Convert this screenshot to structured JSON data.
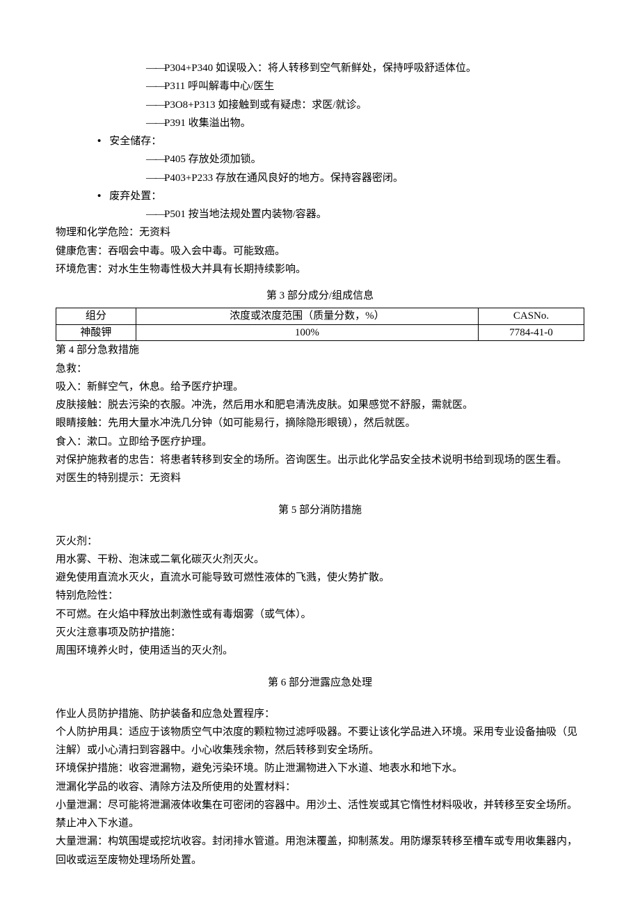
{
  "top": {
    "l1": "P304+P340 如误吸入：将人转移到空气新鲜处，保持呼吸舒适体位。",
    "l2": "P311 呼叫解毒中心/医生",
    "l3": "P3O8+P313 如接触到或有疑虑：求医/就诊。",
    "l4": "P391 收集溢出物。",
    "storage_label": "安全储存：",
    "s1": "P405 存放处须加锁。",
    "s2": "P403+P233 存放在通风良好的地方。保持容器密闭。",
    "disposal_label": "废弃处置：",
    "d1": "P501 按当地法规处置内装物/容器。",
    "phys": "物理和化学危险：无资料",
    "health": "健康危害：吞咽会中毒。吸入会中毒。可能致癌。",
    "env": "环境危害：对水生生物毒性极大并具有长期持续影响。"
  },
  "s3": {
    "title": "第 3 部分成分/组成信息",
    "headers": {
      "c1": "组分",
      "c2": "浓度或浓度范围（质量分数，%）",
      "c3": "CASNo."
    },
    "row": {
      "c1": "神酸钾",
      "c2": "100%",
      "c3": "7784-41-0"
    }
  },
  "s4": {
    "title": "第 4 部分急救措施",
    "l1": "急救：",
    "l2": "吸入：新鲜空气，休息。给予医疗护理。",
    "l3": "皮肤接触：脱去污染的衣服。冲洗，然后用水和肥皂清洗皮肤。如果感觉不舒服，需就医。",
    "l4": "眼睛接触：先用大量水冲洗几分钟（如可能易行，摘除隐形眼镜），然后就医。",
    "l5": "食入：漱口。立即给予医疗护理。",
    "l6": "对保护施救者的忠告：将患者转移到安全的场所。咨询医生。出示此化学品安全技术说明书给到现场的医生看。",
    "l7": "对医生的特别提示：无资料"
  },
  "s5": {
    "title": "第 5 部分消防措施",
    "l1": "灭火剂：",
    "l2": "用水雾、干粉、泡沫或二氧化碳灭火剂灭火。",
    "l3": "避免使用直流水灭火，直流水可能导致可燃性液体的飞溅，使火势扩散。",
    "l4": "特别危险性：",
    "l5": "不可燃。在火焰中释放出刺激性或有毒烟雾（或气体）。",
    "l6": "灭火注意事项及防护措施：",
    "l7": "周围环境养火时，使用适当的灭火剂。"
  },
  "s6": {
    "title": "第 6 部分泄露应急处理",
    "l1": "作业人员防护措施、防护装备和应急处置程序：",
    "l2": "个人防护用具：适应于该物质空气中浓度的颗粒物过滤呼吸器。不要让该化学品进入环境。采用专业设备抽吸（见注解）或小心清扫到容器中。小心收集残余物，然后转移到安全场所。",
    "l3": "环境保护措施：收容泄漏物，避免污染环境。防止泄漏物进入下水道、地表水和地下水。",
    "l4": "泄漏化学品的收容、清除方法及所使用的处置材料：",
    "l5": "小量泄漏：尽可能将泄漏液体收集在可密闭的容器中。用沙土、活性炭或其它惰性材料吸收，并转移至安全场所。禁止冲入下水道。",
    "l6": "大量泄漏：构筑围堤或挖坑收容。封闭排水管道。用泡沫覆盖，抑制蒸发。用防爆泵转移至槽车或专用收集器内，回收或运至废物处理场所处置。"
  }
}
